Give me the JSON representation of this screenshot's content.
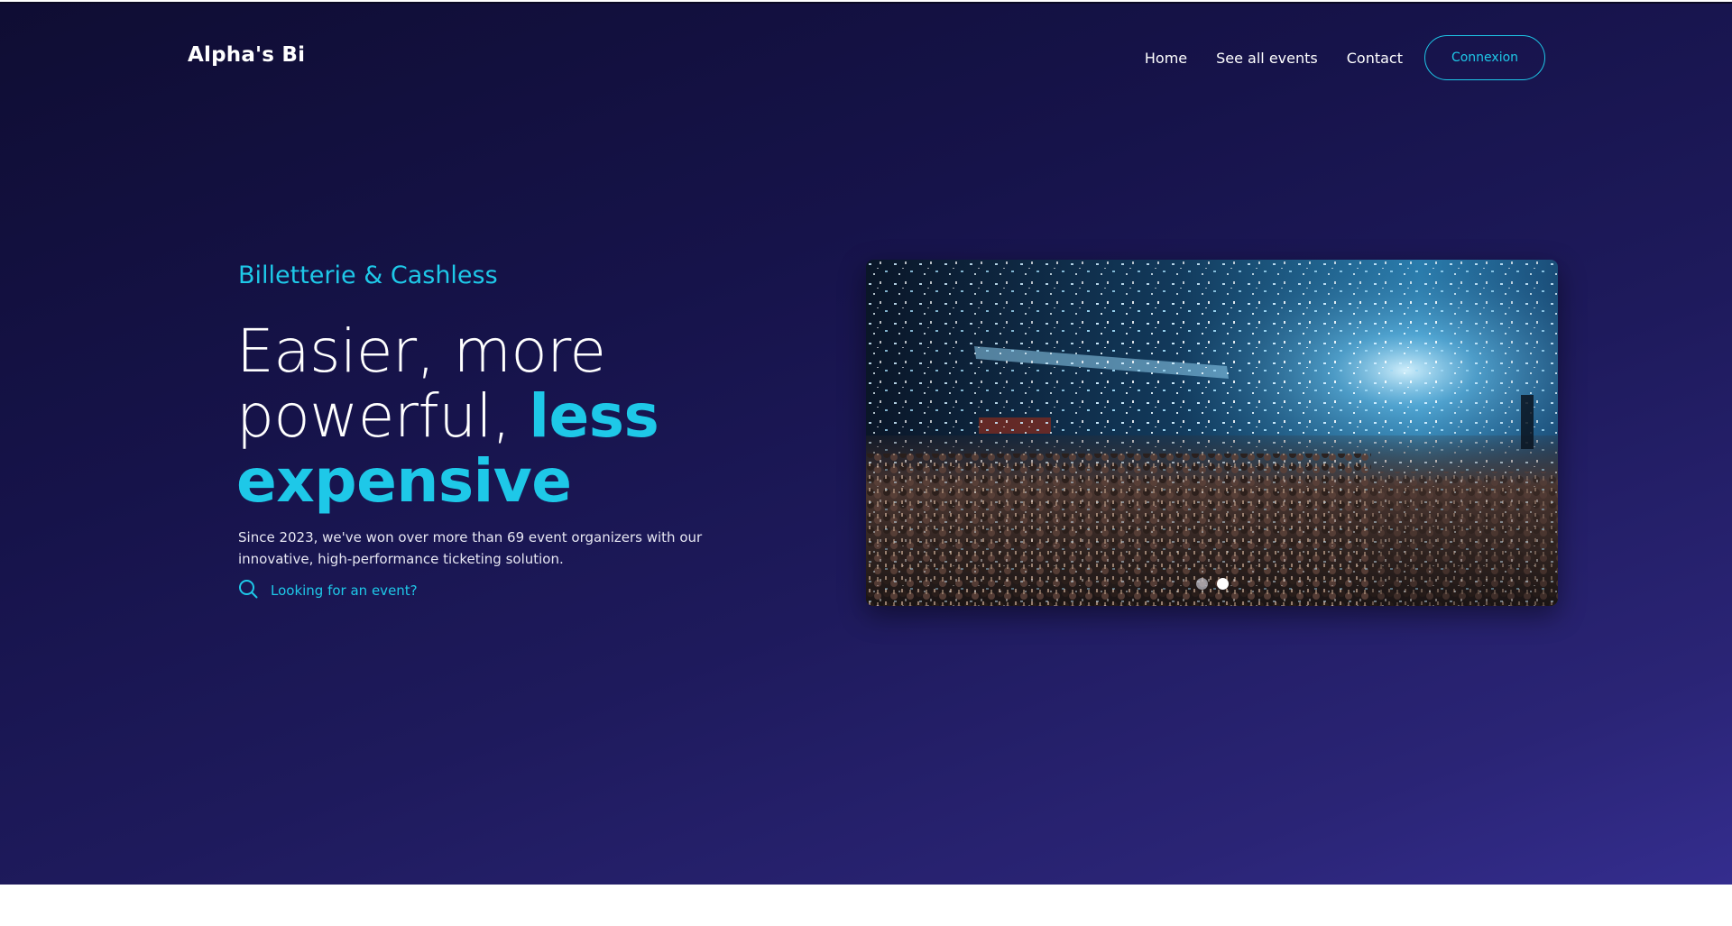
{
  "brand": {
    "name": "Alpha's Bi"
  },
  "nav": {
    "items": [
      {
        "label": "Home"
      },
      {
        "label": "See all events"
      },
      {
        "label": "Contact"
      }
    ],
    "login_label": "Connexion"
  },
  "hero": {
    "eyebrow": "Billetterie & Cashless",
    "headline_line1": "Easier, more",
    "headline_line2_plain": "powerful, ",
    "headline_line2_accent": "less",
    "headline_line3_accent": "expensive",
    "description": "Since 2023, we've won over more than 69 event organizers with our innovative, high-performance ticketing solution.",
    "search_link": "Looking for an event?"
  },
  "carousel": {
    "slide_count": 2,
    "active_index": 1
  },
  "colors": {
    "accent": "#1ec8e8",
    "background_dark": "#0f0d33",
    "background_light": "#342d8e"
  }
}
